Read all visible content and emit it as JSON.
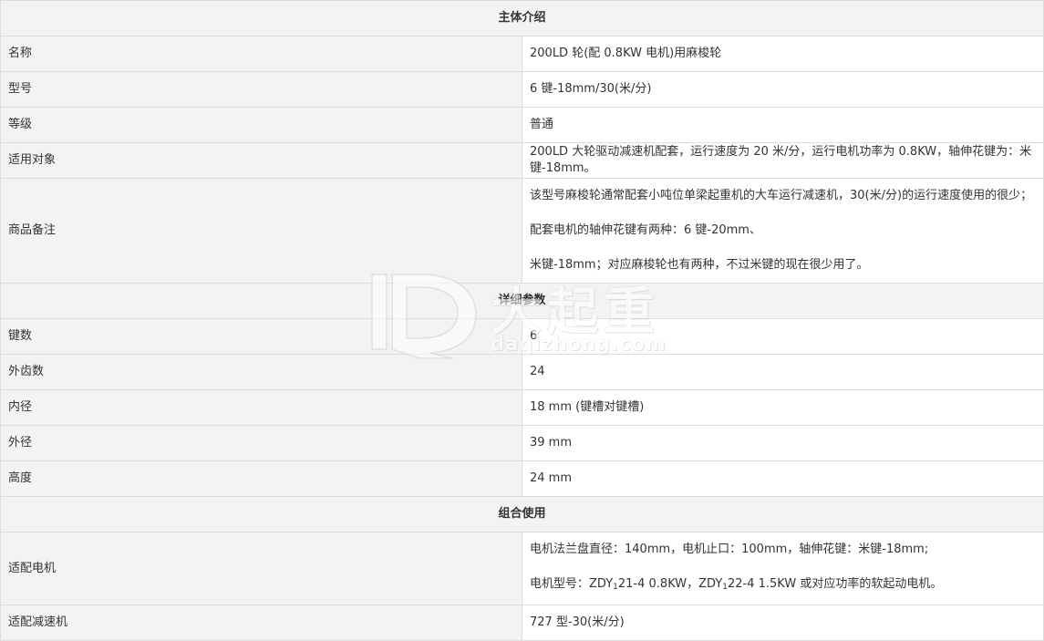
{
  "sections": {
    "intro": "主体介绍",
    "details": "详细参数",
    "combo": "组合使用"
  },
  "intro_rows": [
    {
      "label": "名称",
      "value": "200LD 轮(配 0.8KW 电机)用麻梭轮"
    },
    {
      "label": "型号",
      "value": "6 键-18mm/30(米/分)"
    },
    {
      "label": "等级",
      "value": "普通"
    },
    {
      "label": "适用对象",
      "value": "200LD 大轮驱动减速机配套，运行速度为 20 米/分，运行电机功率为 0.8KW，轴伸花键为：米键-18mm。"
    },
    {
      "label": "商品备注",
      "value_line1": "该型号麻梭轮通常配套小吨位单梁起重机的大车运行减速机，30(米/分)的运行速度使用的很少；配套电机的轴伸花键有两种：6  键-20mm、",
      "value_line2": "米键-18mm；对应麻梭轮也有两种，不过米键的现在很少用了。"
    }
  ],
  "detail_rows": [
    {
      "label": "键数",
      "value": "6"
    },
    {
      "label": "外齿数",
      "value": "24"
    },
    {
      "label": "内径",
      "value": "18 mm (键槽对键槽)"
    },
    {
      "label": "外径",
      "value": "39 mm"
    },
    {
      "label": "高度",
      "value": "24 mm"
    }
  ],
  "combo_rows": {
    "motor": {
      "label": "适配电机",
      "line1": "电机法兰盘直径：140mm，电机止口：100mm，轴伸花键：米键-18mm;",
      "line2_a": "电机型号：ZDY",
      "line2_sub1": "1",
      "line2_b": "21-4    0.8KW，ZDY",
      "line2_sub2": "1",
      "line2_c": "22-4    1.5KW 或对应功率的软起动电机。"
    },
    "reducer": {
      "label": "适配减速机",
      "value": "727 型-30(米/分)"
    }
  },
  "watermark": {
    "cn": "大起重",
    "en": "daqizhong.com"
  }
}
